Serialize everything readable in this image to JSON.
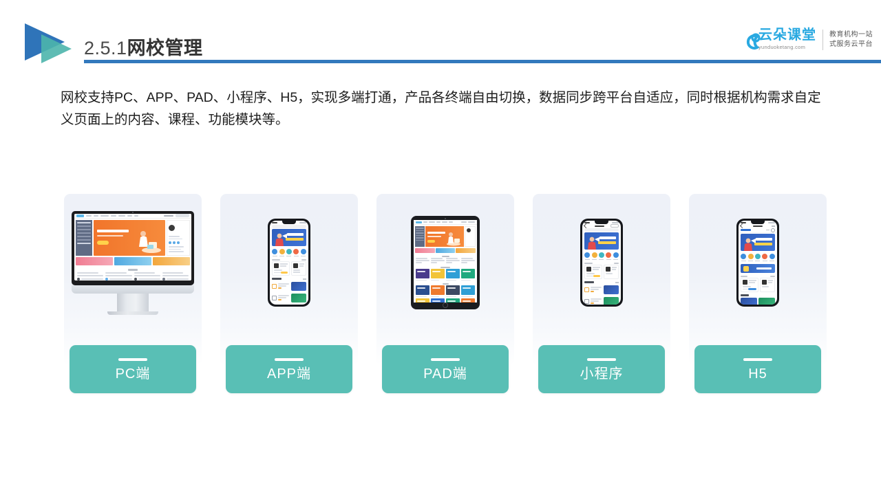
{
  "header": {
    "section_number": "2.5.1",
    "title_zh": "网校管理",
    "logo_icon": "double-triangle-play-logo",
    "rule_color": "#3279bd"
  },
  "brand": {
    "cloud_icon": "cloud-icon",
    "name": "云朵课堂",
    "url": "yunduoketang.com",
    "tagline_line1": "教育机构一站",
    "tagline_line2": "式服务云平台",
    "accent_color": "#29a9e1"
  },
  "body": {
    "paragraph": "网校支持PC、APP、PAD、小程序、H5，实现多端打通，产品各终端自由切换，数据同步跨平台自适应，同时根据机构需求自定义页面上的内容、课程、功能模块等。"
  },
  "cards": [
    {
      "label": "PC端",
      "device": "desktop-monitor",
      "name": "pc"
    },
    {
      "label": "APP端",
      "device": "smartphone",
      "name": "app"
    },
    {
      "label": "PAD端",
      "device": "tablet",
      "name": "pad"
    },
    {
      "label": "小程序",
      "device": "smartphone",
      "name": "miniprogram"
    },
    {
      "label": "H5",
      "device": "smartphone",
      "name": "h5"
    }
  ],
  "theme": {
    "label_button_color": "#59bfb5",
    "card_background": "#eef1f8",
    "page_background": "#ffffff",
    "title_color": "#3f3f3f"
  }
}
